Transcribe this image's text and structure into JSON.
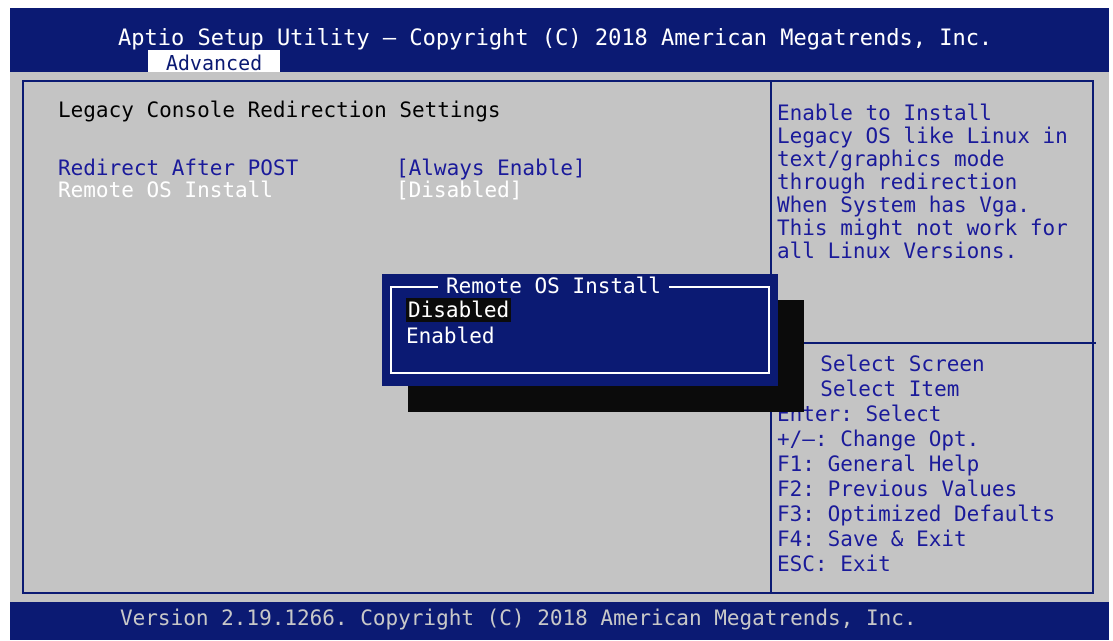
{
  "title_bar": {
    "title": "Aptio Setup Utility – Copyright (C) 2018 American Megatrends, Inc."
  },
  "tabs": [
    {
      "label": "Advanced"
    }
  ],
  "main": {
    "section_title": "Legacy Console Redirection Settings",
    "settings": [
      {
        "label": "Redirect After POST",
        "value": "[Always Enable]",
        "selected": false
      },
      {
        "label": "Remote OS Install",
        "value": "[Disabled]",
        "selected": true
      }
    ]
  },
  "help": {
    "lines": [
      "Enable to Install",
      "Legacy OS like Linux in",
      "text/graphics mode",
      "through redirection",
      "When System has Vga.",
      "This might not work for",
      "all Linux Versions."
    ]
  },
  "keys": {
    "lines": [
      ": Select Screen",
      ": Select Item",
      "Enter: Select",
      "+/–: Change Opt.",
      "F1: General Help",
      "F2: Previous Values",
      "F3: Optimized Defaults",
      "F4: Save & Exit",
      "ESC: Exit"
    ]
  },
  "popup": {
    "title": "Remote OS Install",
    "options": [
      {
        "label": "Disabled",
        "selected": true
      },
      {
        "label": "Enabled",
        "selected": false
      }
    ]
  },
  "footer": {
    "text": "Version 2.19.1266. Copyright (C) 2018 American Megatrends, Inc."
  },
  "colors": {
    "bios_blue": "#0b1a73",
    "panel_gray": "#c4c4c4",
    "text_blue": "#1a1a9a",
    "highlight_white": "#ffffff",
    "shadow_black": "#0b0b0b"
  }
}
